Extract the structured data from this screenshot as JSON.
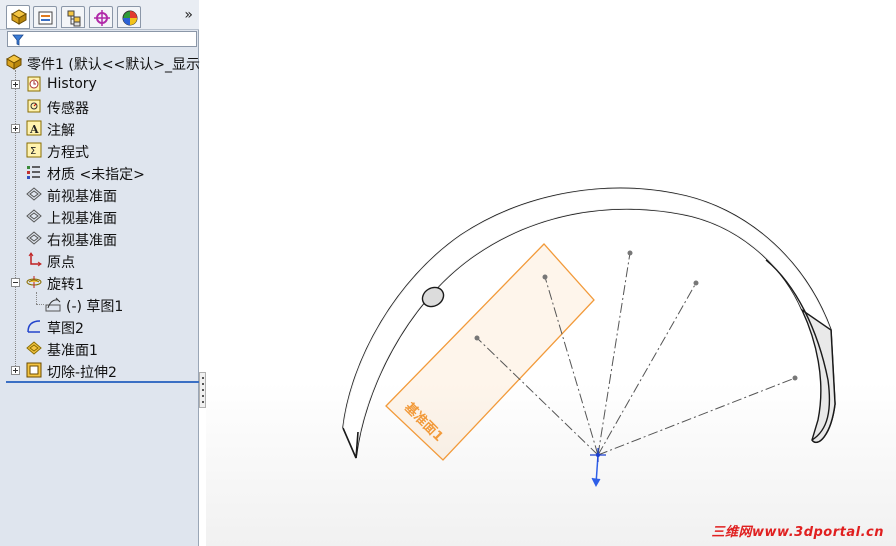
{
  "panel": {
    "tabs": [
      {
        "icon": "feature-manager-icon"
      },
      {
        "icon": "property-manager-icon"
      },
      {
        "icon": "configuration-manager-icon"
      },
      {
        "icon": "dimxpert-manager-icon"
      },
      {
        "icon": "display-manager-icon"
      }
    ],
    "overflow": "»",
    "filter_icon": "filter-icon"
  },
  "tree": {
    "root": {
      "label": "零件1  (默认<<默认>_显示",
      "icon": "part-icon"
    },
    "items": [
      {
        "label": "History",
        "icon": "history-icon",
        "expander": "plus"
      },
      {
        "label": "传感器",
        "icon": "sensor-icon",
        "expander": "none"
      },
      {
        "label": "注解",
        "icon": "annotations-icon",
        "expander": "plus"
      },
      {
        "label": "方程式",
        "icon": "equations-icon",
        "expander": "none"
      },
      {
        "label": "材质 <未指定>",
        "icon": "material-icon",
        "expander": "none"
      },
      {
        "label": "前视基准面",
        "icon": "plane-icon",
        "expander": "none"
      },
      {
        "label": "上视基准面",
        "icon": "plane-icon",
        "expander": "none"
      },
      {
        "label": "右视基准面",
        "icon": "plane-icon",
        "expander": "none"
      },
      {
        "label": "原点",
        "icon": "origin-icon",
        "expander": "none"
      },
      {
        "label": "旋转1",
        "icon": "revolve-icon",
        "expander": "minus"
      },
      {
        "label": "(-) 草图1",
        "icon": "sketch-icon",
        "expander": "child"
      },
      {
        "label": "草图2",
        "icon": "sketch-icon",
        "expander": "none"
      },
      {
        "label": "基准面1",
        "icon": "plane-selected-icon",
        "expander": "none"
      },
      {
        "label": "切除-拉伸2",
        "icon": "cut-extrude-icon",
        "expander": "plus"
      }
    ]
  },
  "graphics": {
    "plane_label": "基准面1",
    "watermark": "三维网www.3dportal.cn",
    "colors": {
      "plane": "#f29a3a",
      "axis_blue": "#1a3fd0",
      "triad_blue": "#2e5fe8"
    }
  }
}
